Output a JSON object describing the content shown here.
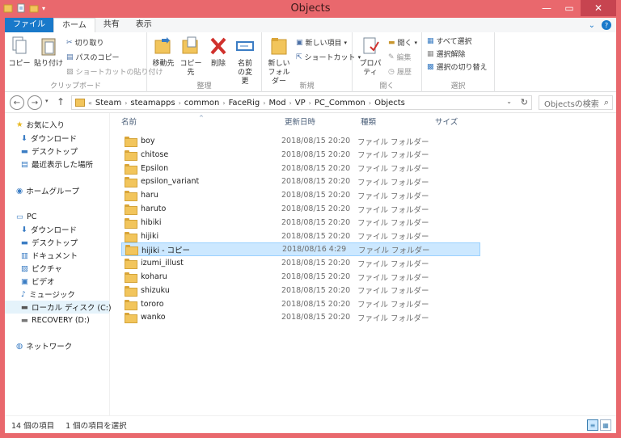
{
  "window": {
    "title": "Objects"
  },
  "colors": {
    "titlebar": "#e9686d",
    "file_tab": "#1979ca",
    "selection": "#cce8ff",
    "folder": "#f2c55c"
  },
  "tabs": [
    {
      "label": "ファイル",
      "kind": "file"
    },
    {
      "label": "ホーム",
      "kind": "active"
    },
    {
      "label": "共有",
      "kind": ""
    },
    {
      "label": "表示",
      "kind": ""
    }
  ],
  "ribbon": {
    "clipboard": {
      "label": "クリップボード",
      "copy": "コピー",
      "paste": "貼り付け",
      "cut": "切り取り",
      "copy_path": "パスのコピー",
      "paste_shortcut": "ショートカットの貼り付け"
    },
    "organize": {
      "label": "整理",
      "move_to": "移動先",
      "copy_to": "コピー先",
      "delete": "削除",
      "rename": "名前の変更"
    },
    "new": {
      "label": "新規",
      "new_folder": "新しいフォルダー",
      "new_item": "新しい項目",
      "easy_access": "ショートカット"
    },
    "open": {
      "label": "開く",
      "properties": "プロパティ",
      "open": "開く",
      "edit": "編集",
      "history": "履歴"
    },
    "select": {
      "label": "選択",
      "select_all": "すべて選択",
      "select_none": "選択解除",
      "invert": "選択の切り替え"
    }
  },
  "address": {
    "crumbs": [
      "Steam",
      "steamapps",
      "common",
      "FaceRig",
      "Mod",
      "VP",
      "PC_Common",
      "Objects"
    ],
    "search_placeholder": "Objectsの検索"
  },
  "navigation": {
    "favorites": "お気に入り",
    "fav_items": [
      "ダウンロード",
      "デスクトップ",
      "最近表示した場所"
    ],
    "homegroup": "ホームグループ",
    "pc": "PC",
    "pc_items": [
      "ダウンロード",
      "デスクトップ",
      "ドキュメント",
      "ピクチャ",
      "ビデオ",
      "ミュージック"
    ],
    "local_disk": "ローカル ディスク (C:)",
    "recovery": "RECOVERY (D:)",
    "network": "ネットワーク"
  },
  "columns": {
    "name": "名前",
    "date": "更新日時",
    "type": "種類",
    "size": "サイズ"
  },
  "files": [
    {
      "name": "boy",
      "date": "2018/08/15 20:20",
      "type": "ファイル フォルダー"
    },
    {
      "name": "chitose",
      "date": "2018/08/15 20:20",
      "type": "ファイル フォルダー"
    },
    {
      "name": "Epsilon",
      "date": "2018/08/15 20:20",
      "type": "ファイル フォルダー"
    },
    {
      "name": "epsilon_variant",
      "date": "2018/08/15 20:20",
      "type": "ファイル フォルダー"
    },
    {
      "name": "haru",
      "date": "2018/08/15 20:20",
      "type": "ファイル フォルダー"
    },
    {
      "name": "haruto",
      "date": "2018/08/15 20:20",
      "type": "ファイル フォルダー"
    },
    {
      "name": "hibiki",
      "date": "2018/08/15 20:20",
      "type": "ファイル フォルダー"
    },
    {
      "name": "hijiki",
      "date": "2018/08/15 20:20",
      "type": "ファイル フォルダー"
    },
    {
      "name": "hijiki - コピー",
      "date": "2018/08/16 4:29",
      "type": "ファイル フォルダー",
      "selected": true
    },
    {
      "name": "izumi_illust",
      "date": "2018/08/15 20:20",
      "type": "ファイル フォルダー"
    },
    {
      "name": "koharu",
      "date": "2018/08/15 20:20",
      "type": "ファイル フォルダー"
    },
    {
      "name": "shizuku",
      "date": "2018/08/15 20:20",
      "type": "ファイル フォルダー"
    },
    {
      "name": "tororo",
      "date": "2018/08/15 20:20",
      "type": "ファイル フォルダー"
    },
    {
      "name": "wanko",
      "date": "2018/08/15 20:20",
      "type": "ファイル フォルダー"
    }
  ],
  "status": {
    "count": "14 個の項目",
    "selected": "1 個の項目を選択"
  }
}
